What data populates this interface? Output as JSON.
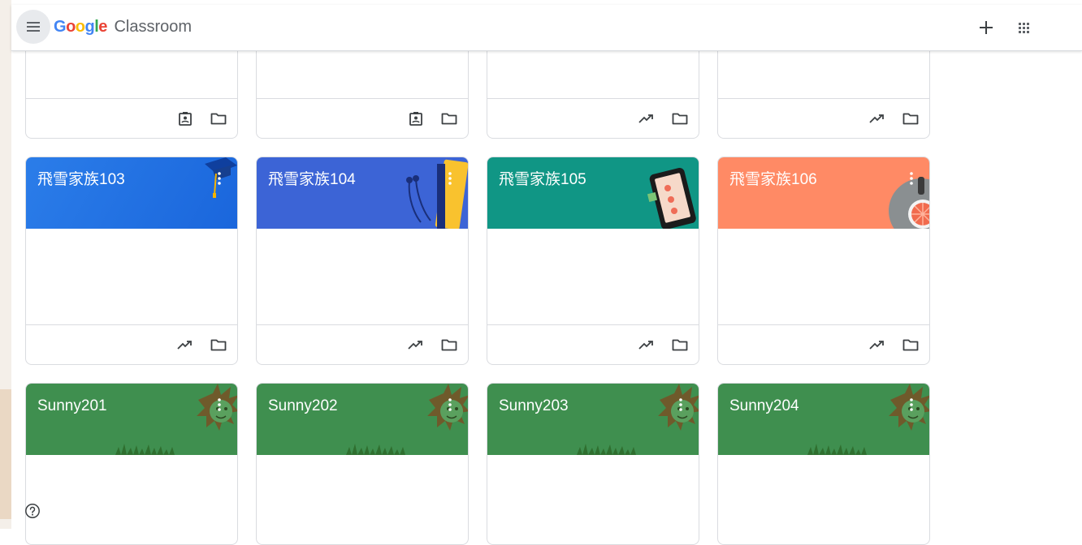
{
  "header": {
    "brand_google_letters": [
      "G",
      "o",
      "o",
      "g",
      "l",
      "e"
    ],
    "brand_google_colors": [
      "#4285F4",
      "#EA4335",
      "#FBBC05",
      "#4285F4",
      "#34A853",
      "#EA4335"
    ],
    "brand_product": "Classroom",
    "icons": [
      "menu-icon",
      "add-icon",
      "apps-grid-icon"
    ]
  },
  "colors": {
    "blue_103": "#1e6fe6",
    "indigo_104": "#3c64d6",
    "teal_105": "#109685",
    "orange_106": "#ff8a65",
    "green_sunny": "#3f8f4f",
    "icon": "#3c4043"
  },
  "classes_row1": [
    {
      "footer_icons": [
        "assignment-ind-icon",
        "folder-icon"
      ]
    },
    {
      "footer_icons": [
        "assignment-ind-icon",
        "folder-icon"
      ]
    },
    {
      "footer_icons": [
        "trending-icon",
        "folder-icon"
      ]
    },
    {
      "footer_icons": [
        "trending-icon",
        "folder-icon"
      ]
    }
  ],
  "classes_row2": [
    {
      "name": "飛雪家族103",
      "footer_icons": [
        "trending-icon",
        "folder-icon"
      ]
    },
    {
      "name": "飛雪家族104",
      "footer_icons": [
        "trending-icon",
        "folder-icon"
      ]
    },
    {
      "name": "飛雪家族105",
      "footer_icons": [
        "trending-icon",
        "folder-icon"
      ]
    },
    {
      "name": "飛雪家族106",
      "footer_icons": [
        "trending-icon",
        "folder-icon"
      ]
    }
  ],
  "classes_row3": [
    {
      "name": "Sunny201"
    },
    {
      "name": "Sunny202"
    },
    {
      "name": "Sunny203"
    },
    {
      "name": "Sunny204"
    }
  ],
  "help": {
    "icon": "help-icon"
  }
}
